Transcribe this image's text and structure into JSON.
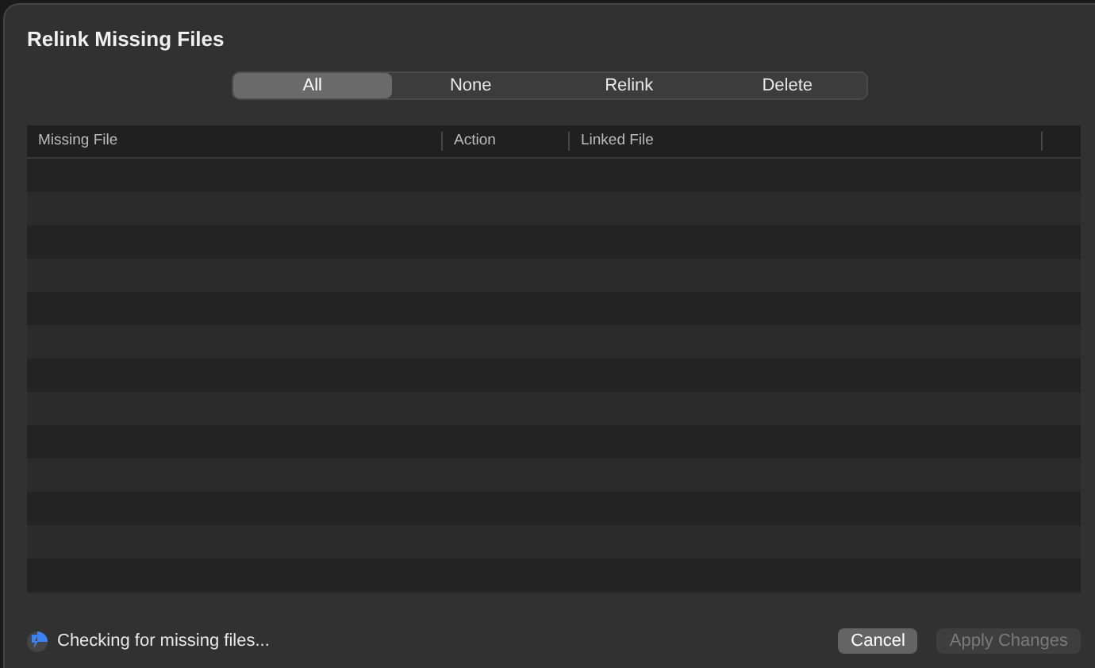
{
  "window": {
    "title": "Relink Missing Files"
  },
  "segments": [
    {
      "label": "All",
      "selected": true
    },
    {
      "label": "None",
      "selected": false
    },
    {
      "label": "Relink",
      "selected": false
    },
    {
      "label": "Delete",
      "selected": false
    }
  ],
  "table": {
    "columns": [
      "Missing File",
      "Action",
      "Linked File"
    ]
  },
  "status": {
    "text": "Checking for missing files...",
    "busy": true
  },
  "buttons": [
    {
      "label": "Cancel",
      "disabled": false
    },
    {
      "label": "Apply Changes",
      "disabled": true
    }
  ]
}
